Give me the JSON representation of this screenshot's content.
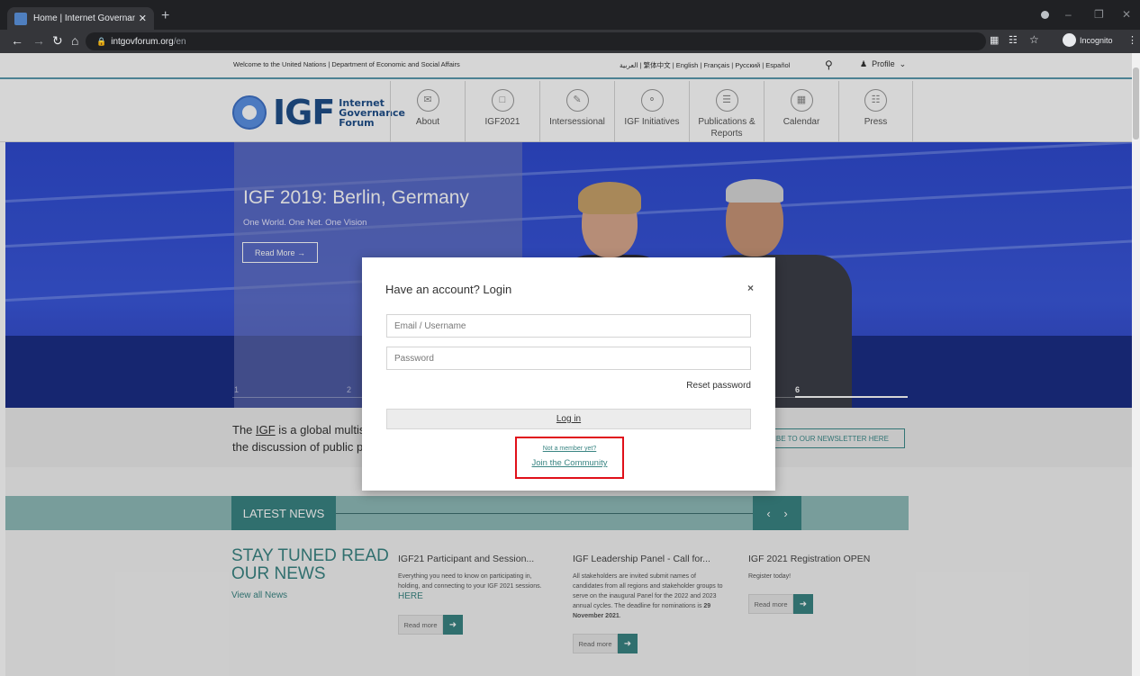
{
  "browser": {
    "tab_title": "Home | Internet Governance Foru",
    "tab_close": "✕",
    "new_tab": "+",
    "url_domain": "intgovforum.org",
    "url_path": "/en",
    "incognito_label": "Incognito",
    "icons": [
      "back-icon",
      "forward-icon",
      "reload-icon",
      "home-icon",
      "lock-icon",
      "star-icon",
      "incognito-icon"
    ]
  },
  "topbar": {
    "welcome": "Welcome to the United Nations | Department of Economic and Social Affairs",
    "languages": "العربية | 繁体中文 | English | Français | Русский | Español",
    "profile": "Profile"
  },
  "logo": {
    "abbr": "IGF",
    "line1": "Internet",
    "line2": "Governance",
    "line3": "Forum"
  },
  "menu": [
    {
      "label": "About",
      "icon": "info-icon"
    },
    {
      "label": "IGF2021",
      "icon": "calendar-icon"
    },
    {
      "label": "Intersessional",
      "icon": "pen-icon"
    },
    {
      "label": "IGF Initiatives",
      "icon": "bulb-icon"
    },
    {
      "label": "Publications & Reports",
      "icon": "document-icon"
    },
    {
      "label": "Calendar",
      "icon": "calendar-grid-icon"
    },
    {
      "label": "Press",
      "icon": "press-icon"
    }
  ],
  "hero": {
    "title": "IGF 2019: Berlin, Germany",
    "subtitle": "One World. One Net. One Vision",
    "button": "Read More",
    "slides": [
      "1",
      "2",
      "6"
    ]
  },
  "intro": {
    "line1_prefix": "The ",
    "line1_igf": "IGF",
    "line1_rest": " is a global multis",
    "line2": "the discussion of public p",
    "newsletter": "CRIBE TO OUR NEWSLETTER HERE"
  },
  "news": {
    "label": "LATEST NEWS",
    "prev": "‹",
    "next": "›",
    "stay": "STAY TUNED READ OUR NEWS",
    "view_all": "View all News",
    "read_more": "Read more",
    "articles": [
      {
        "title": "IGF21 Participant and Session...",
        "body": "Everything you need to know on participating in, holding, and connecting to your IGF 2021 sessions.",
        "highlight": "HERE"
      },
      {
        "title": "IGF Leadership Panel - Call for...",
        "body": "All stakeholders are invited submit names of candidates from all regions and stakeholder groups to serve on the inaugural Panel for the 2022 and 2023 annual cycles. The deadline for nominations is ",
        "highlight": "29 November 2021",
        "tail": "."
      },
      {
        "title": "IGF 2021 Registration OPEN",
        "body": "Register today!",
        "highlight": ""
      }
    ]
  },
  "modal": {
    "title": "Have an account? Login",
    "close": "×",
    "email_placeholder": "Email / Username",
    "password_placeholder": "Password",
    "reset": "Reset password",
    "login": "Log in",
    "not_member": "Not a member yet?",
    "join": "Join the Community",
    "highlight_color": "#e0101a"
  }
}
